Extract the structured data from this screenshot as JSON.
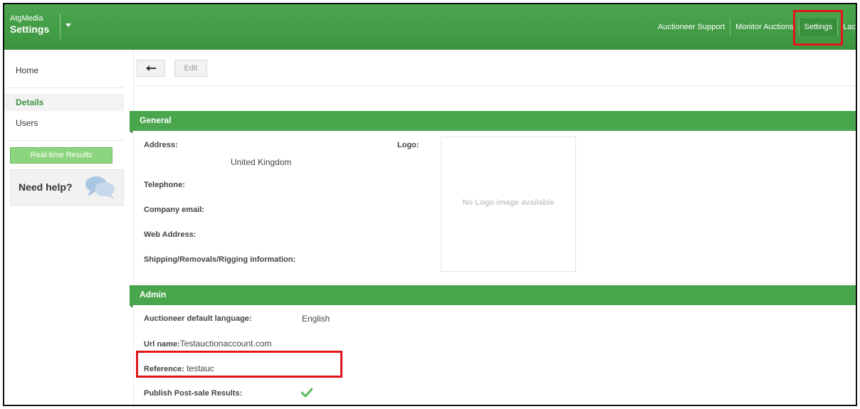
{
  "header": {
    "brand_name": "AtgMedia",
    "brand_section": "Settings",
    "nav": [
      "Auctioneer Support",
      "Monitor Auctions",
      "Settings",
      "Lac"
    ]
  },
  "sidebar": {
    "home": "Home",
    "details": "Details",
    "users": "Users",
    "realtime_button": "Real-time Results",
    "help_text": "Need help?"
  },
  "toolbar": {
    "back_icon": "arrow-left-icon",
    "edit_label": "Edit"
  },
  "general": {
    "title": "General",
    "address_label": "Address:",
    "address_value": "United Kingdom",
    "telephone_label": "Telephone:",
    "email_label": "Company email:",
    "web_label": "Web Address:",
    "shipping_label": "Shipping/Removals/Rigging information:",
    "logo_label": "Logo:",
    "logo_placeholder": "No Logo image available"
  },
  "admin": {
    "title": "Admin",
    "language_label": "Auctioneer default language:",
    "language_value": "English",
    "url_label": "Url name:",
    "url_value": "Testauctionaccount.com",
    "reference_label": "Reference:",
    "reference_value": "testauc",
    "publish_label": "Publish Post-sale Results:",
    "publish_icon": "checkmark-icon"
  },
  "colors": {
    "brand_green": "#4aa64d",
    "highlight_red": "#e0161b",
    "check_green": "#5cb85c"
  }
}
